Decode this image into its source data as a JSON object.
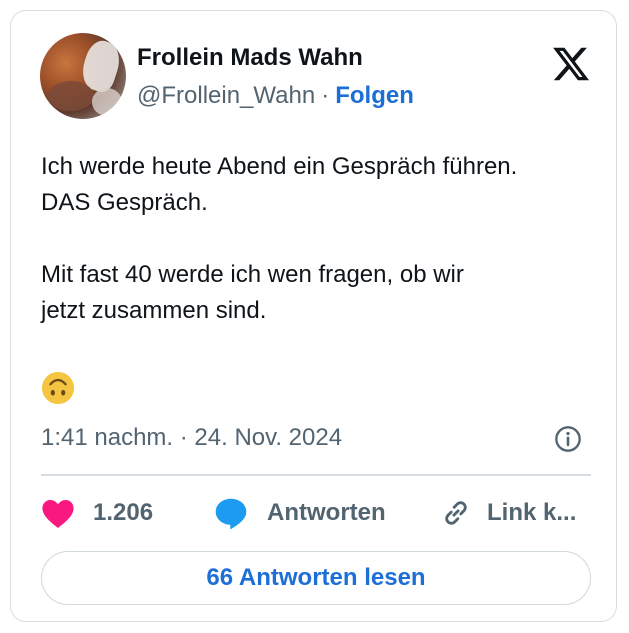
{
  "author": {
    "name": "Frollein Mads Wahn",
    "handle": "@Frollein_Wahn",
    "separator": "·",
    "follow_label": "Folgen"
  },
  "platform_icon": "x-logo-icon",
  "tweet": {
    "lines": [
      "Ich werde heute Abend ein Gespräch führen.",
      "DAS Gespräch.",
      "",
      "Mit fast 40 werde ich wen fragen, ob wir",
      "jetzt zusammen sind."
    ],
    "emoji": "upside-down-face-icon"
  },
  "timestamp": "1:41 nachm. · 24. Nov. 2024",
  "actions": {
    "like_count": "1.206",
    "reply_label": "Antworten",
    "link_label": "Link k..."
  },
  "read_replies_label": "66 Antworten lesen",
  "colors": {
    "like": "#f91880",
    "reply": "#1d9bf0",
    "accent": "#1d6fd8",
    "muted": "#536471",
    "emoji": "#f5c542"
  }
}
